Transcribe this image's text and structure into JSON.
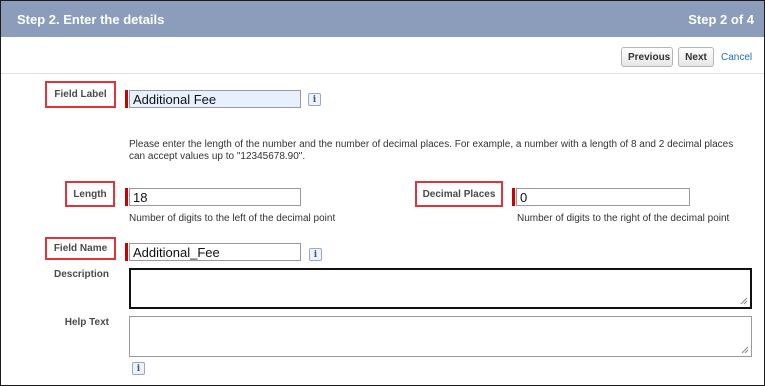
{
  "header": {
    "title": "Step 2. Enter the details",
    "step": "Step 2 of 4"
  },
  "toolbar": {
    "previous_label": "Previous",
    "next_label": "Next",
    "cancel_label": "Cancel"
  },
  "form": {
    "field_label": {
      "label": "Field Label",
      "value": "Additional Fee"
    },
    "instructions": "Please enter the length of the number and the number of decimal places. For example, a number with a length of 8 and 2 decimal places can accept values up to \"12345678.90\".",
    "length": {
      "label": "Length",
      "value": "18",
      "hint": "Number of digits to the left of the decimal point"
    },
    "decimal_places": {
      "label": "Decimal Places",
      "value": "0",
      "hint": "Number of digits to the right of the decimal point"
    },
    "field_name": {
      "label": "Field Name",
      "value": "Additional_Fee"
    },
    "description": {
      "label": "Description",
      "value": ""
    },
    "help_text": {
      "label": "Help Text",
      "value": ""
    }
  },
  "icons": {
    "info": "i"
  }
}
